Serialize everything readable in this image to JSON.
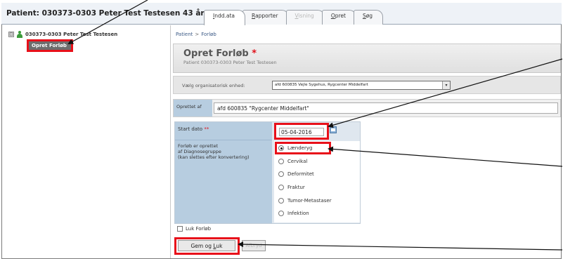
{
  "header": {
    "title": "Patient: 030373-0303 Peter Test Testesen 43 år",
    "tabs": [
      {
        "label_prefix": "",
        "label_underline": "I",
        "label_rest": "ndd.ata",
        "state": "active"
      },
      {
        "label_prefix": "",
        "label_underline": "R",
        "label_rest": "apporter",
        "state": "normal"
      },
      {
        "label_prefix": "",
        "label_underline": "V",
        "label_rest": "isning",
        "state": "disabled"
      },
      {
        "label_prefix": "",
        "label_underline": "O",
        "label_rest": "pret",
        "state": "normal"
      },
      {
        "label_prefix": "",
        "label_underline": "S",
        "label_rest": "øg",
        "state": "normal"
      }
    ]
  },
  "tree": {
    "toggle": "⊟",
    "patient_label": "030373-0303 Peter Test Testesen",
    "opret_forlob_button": "Opret Forløb"
  },
  "breadcrumb": {
    "root": "Patient",
    "separator": ">",
    "current": "Forløb"
  },
  "form": {
    "title": "Opret Forløb",
    "required_mark": "*",
    "subtitle": "Patient 030373-0303 Peter Test Testesen",
    "org_label": "Vælg organisatorisk enhed:",
    "org_value": "afd 600835 Vejle Sygehus, Rygcenter Middelfart",
    "oprettet_label": "Oprettet af",
    "oprettet_value": "afd 600835 \"Rygcenter Middelfart\"",
    "start_label": "Start dato",
    "start_required": "**",
    "start_value": "05-04-2016",
    "forlob_label_lines": [
      "Forløb er oprettet",
      "af Diagnosegruppe",
      "(kan slettes efter konvertering)"
    ],
    "radio_options": [
      {
        "label": "Lænderyg",
        "checked": true
      },
      {
        "label": "Cervikal",
        "checked": false
      },
      {
        "label": "Deformitet",
        "checked": false
      },
      {
        "label": "Fraktur",
        "checked": false
      },
      {
        "label": "Tumor-Metastaser",
        "checked": false
      },
      {
        "label": "Infektion",
        "checked": false
      }
    ],
    "luk_forlob_label": "Luk Forløb",
    "gem_button_prefix": "Gem og ",
    "gem_button_underline": "L",
    "gem_button_rest": "uk",
    "second_button": "Afbryd"
  }
}
